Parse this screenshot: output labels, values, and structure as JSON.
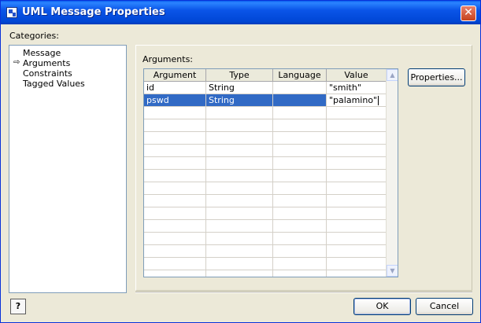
{
  "window": {
    "title": "UML Message Properties",
    "close_glyph": "✕",
    "icon": "uml-app-icon"
  },
  "categories": {
    "label": "Categories:",
    "items": [
      "Message",
      "Arguments",
      "Constraints",
      "Tagged Values"
    ],
    "selected_index": 1,
    "selected_marker": "⇨"
  },
  "arguments": {
    "label": "Arguments:",
    "columns": [
      "Argument",
      "Type",
      "Language",
      "Value"
    ],
    "rows": [
      {
        "argument": "id",
        "type": "String",
        "language": "",
        "value": "\"smith\""
      },
      {
        "argument": "pswd",
        "type": "String",
        "language": "",
        "value": "\"palamino\""
      }
    ],
    "selected_row": 1,
    "editing_cell": "value"
  },
  "buttons": {
    "properties": "Properties...",
    "ok": "OK",
    "cancel": "Cancel",
    "help": "?"
  },
  "scrollbar": {
    "up_glyph": "▲",
    "down_glyph": "▼"
  }
}
